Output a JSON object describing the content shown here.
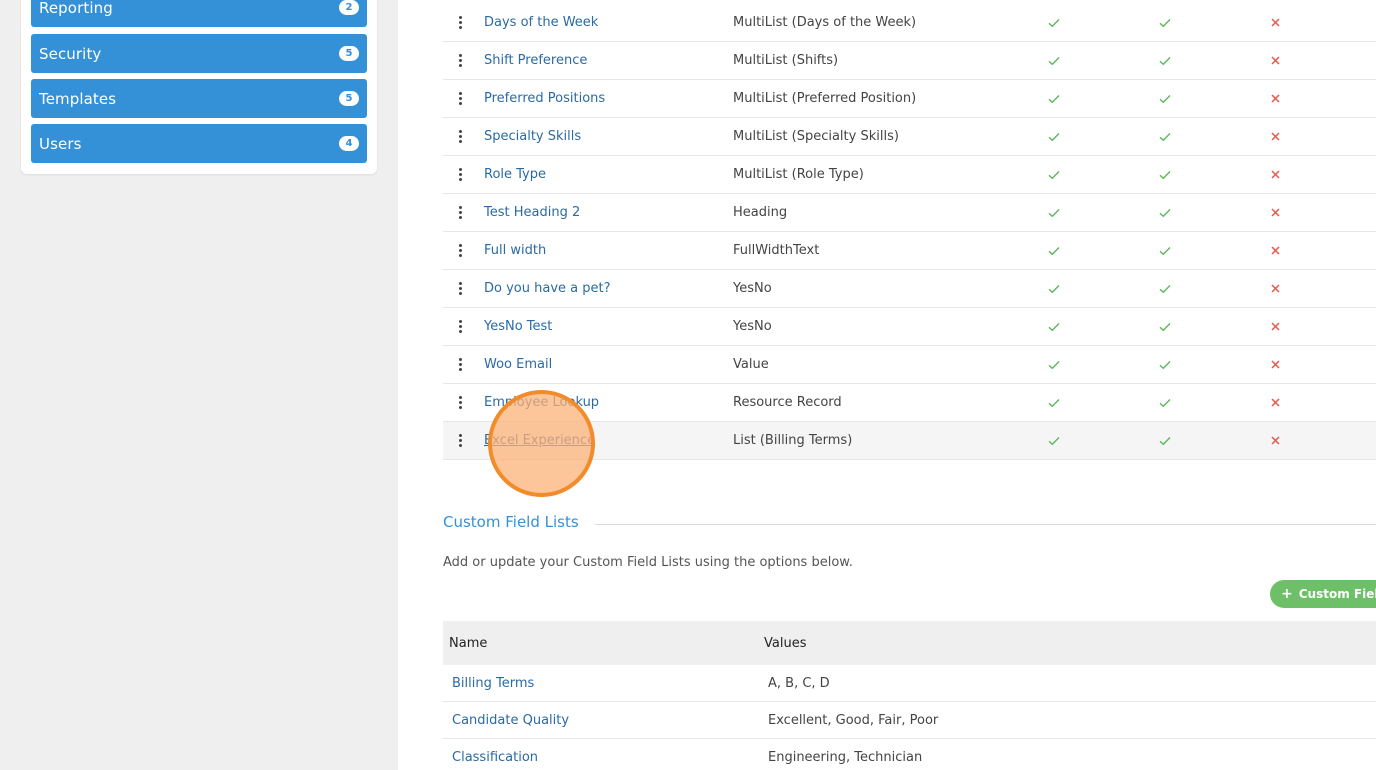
{
  "sidebar": {
    "items": [
      {
        "label": "Reporting",
        "badge": "2"
      },
      {
        "label": "Security",
        "badge": "5"
      },
      {
        "label": "Templates",
        "badge": "5"
      },
      {
        "label": "Users",
        "badge": "4"
      }
    ]
  },
  "fields": [
    {
      "name": "Days of the Week",
      "type": "MultiList (Days of the Week)"
    },
    {
      "name": "Shift Preference",
      "type": "MultiList (Shifts)"
    },
    {
      "name": "Preferred Positions",
      "type": "MultiList (Preferred Position)"
    },
    {
      "name": "Specialty Skills",
      "type": "MultiList (Specialty Skills)"
    },
    {
      "name": "Role Type",
      "type": "MultiList (Role Type)"
    },
    {
      "name": "Test Heading 2",
      "type": "Heading"
    },
    {
      "name": "Full width",
      "type": "FullWidthText"
    },
    {
      "name": "Do you have a pet?",
      "type": "YesNo"
    },
    {
      "name": "YesNo Test",
      "type": "YesNo"
    },
    {
      "name": "Woo Email",
      "type": "Value"
    },
    {
      "name": "Employee Lookup",
      "type": "Resource Record"
    },
    {
      "name": "Excel Experience",
      "type": "List (Billing Terms)"
    }
  ],
  "custom_field_lists": {
    "title": "Custom Field Lists",
    "description": "Add or update your Custom Field Lists using the options below.",
    "add_button": "Custom Field L",
    "columns": {
      "name": "Name",
      "values": "Values"
    },
    "rows": [
      {
        "name": "Billing Terms",
        "values": "A, B, C, D"
      },
      {
        "name": "Candidate Quality",
        "values": "Excellent, Good, Fair, Poor"
      },
      {
        "name": "Classification",
        "values": "Engineering, Technician"
      }
    ]
  },
  "colors": {
    "accent": "#3591d7",
    "link": "#2b6aa3",
    "check": "#5cb85c",
    "cross": "#e05a4e",
    "add_button": "#6ec068"
  }
}
